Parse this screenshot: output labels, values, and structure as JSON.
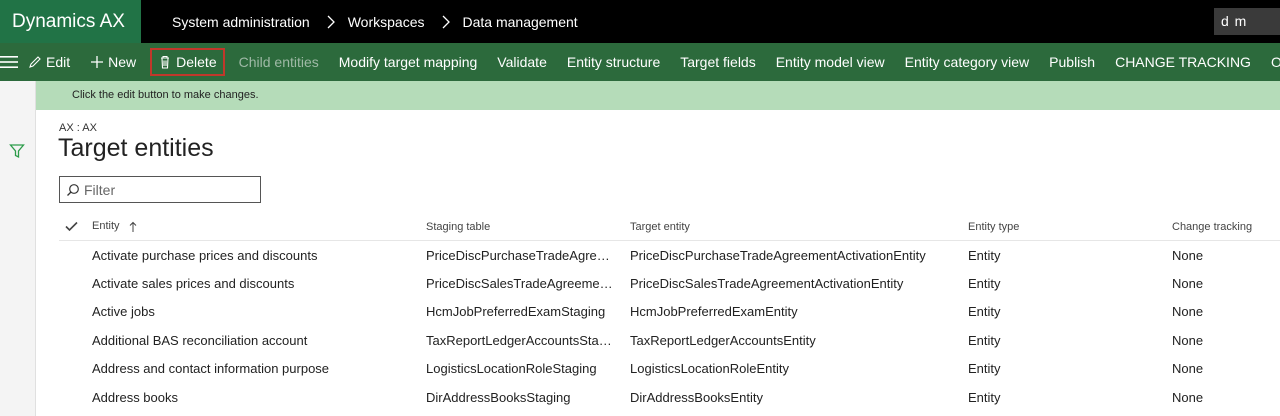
{
  "app": {
    "brand": "Dynamics AX",
    "user_initials": "d m"
  },
  "breadcrumb": [
    "System administration",
    "Workspaces",
    "Data management"
  ],
  "actions": {
    "edit": "Edit",
    "new": "New",
    "delete": "Delete",
    "child_entities": "Child entities",
    "modify_target_mapping": "Modify target mapping",
    "validate": "Validate",
    "entity_structure": "Entity structure",
    "target_fields": "Target fields",
    "entity_model_view": "Entity model view",
    "entity_category_view": "Entity category view",
    "publish": "Publish",
    "change_tracking": "CHANGE TRACKING",
    "options": "OPTIONS"
  },
  "message": "Click the edit button to make changes.",
  "page": {
    "company": "AX : AX",
    "title": "Target entities"
  },
  "filter": {
    "placeholder": "Filter"
  },
  "grid": {
    "headers": {
      "entity": "Entity",
      "staging": "Staging table",
      "target": "Target entity",
      "type": "Entity type",
      "tracking": "Change tracking"
    },
    "rows": [
      {
        "entity": "Activate purchase prices and discounts",
        "staging": "PriceDiscPurchaseTradeAgreem...",
        "target": "PriceDiscPurchaseTradeAgreementActivationEntity",
        "type": "Entity",
        "tracking": "None"
      },
      {
        "entity": "Activate sales prices and discounts",
        "staging": "PriceDiscSalesTradeAgreement...",
        "target": "PriceDiscSalesTradeAgreementActivationEntity",
        "type": "Entity",
        "tracking": "None"
      },
      {
        "entity": "Active jobs",
        "staging": "HcmJobPreferredExamStaging",
        "target": "HcmJobPreferredExamEntity",
        "type": "Entity",
        "tracking": "None"
      },
      {
        "entity": "Additional BAS reconciliation account",
        "staging": "TaxReportLedgerAccountsStagi...",
        "target": "TaxReportLedgerAccountsEntity",
        "type": "Entity",
        "tracking": "None"
      },
      {
        "entity": "Address and contact information purpose",
        "staging": "LogisticsLocationRoleStaging",
        "target": "LogisticsLocationRoleEntity",
        "type": "Entity",
        "tracking": "None"
      },
      {
        "entity": "Address books",
        "staging": "DirAddressBooksStaging",
        "target": "DirAddressBooksEntity",
        "type": "Entity",
        "tracking": "None"
      }
    ]
  },
  "colors": {
    "brand": "#217346",
    "actionbar": "#2c6a3c",
    "message_bar": "#b5dcb9",
    "highlight": "#c0382b"
  }
}
